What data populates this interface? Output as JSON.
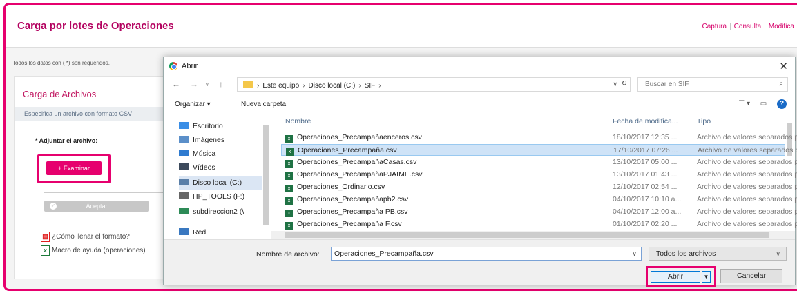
{
  "page": {
    "title": "Carga por lotes de Operaciones",
    "nav": [
      "Captura",
      "Consulta",
      "Modifica"
    ],
    "required_note": "Todos los datos con ( *) son requeridos."
  },
  "panel": {
    "title": "Carga de Archivos",
    "hint": "Especifica un archivo con formato CSV",
    "attach_label": "* Adjuntar el archivo:",
    "browse_button": "+ Examinar",
    "accept_button": "Aceptar",
    "link_format": "¿Cómo llenar el formato?",
    "link_macro": "Macro de ayuda (operaciones)"
  },
  "dialog": {
    "title": "Abrir",
    "breadcrumb": [
      "Este equipo",
      "Disco local (C:)",
      "SIF"
    ],
    "search_placeholder": "Buscar en SIF",
    "organize": "Organizar ▾",
    "new_folder": "Nueva carpeta",
    "tree": [
      {
        "label": "Escritorio",
        "icon": "desktop-icon",
        "color": "#3a8ee6"
      },
      {
        "label": "Imágenes",
        "icon": "pictures-icon",
        "color": "#5b8fc9"
      },
      {
        "label": "Música",
        "icon": "music-icon",
        "color": "#2f7bd0"
      },
      {
        "label": "Vídeos",
        "icon": "videos-icon",
        "color": "#3c4a5c"
      },
      {
        "label": "Disco local (C:)",
        "icon": "drive-icon",
        "color": "#5a7fa8"
      },
      {
        "label": "HP_TOOLS (F:)",
        "icon": "drive-icon",
        "color": "#666666"
      },
      {
        "label": "subdireccion2 (\\",
        "icon": "network-drive-icon",
        "color": "#2e8b57"
      },
      {
        "label": "Red",
        "icon": "network-icon",
        "color": "#3a78c0"
      }
    ],
    "columns": [
      "Nombre",
      "Fecha de modifica...",
      "Tipo"
    ],
    "files": [
      {
        "name": "Operaciones_Precampañaenceros.csv",
        "date": "18/10/2017 12:35 ...",
        "type": "Archivo de valores separados por coma"
      },
      {
        "name": "Operaciones_Precampaña.csv",
        "date": "17/10/2017 07:26 ...",
        "type": "Archivo de valores separados por coma"
      },
      {
        "name": "Operaciones_PrecampañaCasas.csv",
        "date": "13/10/2017 05:00 ...",
        "type": "Archivo de valores separados por coma"
      },
      {
        "name": "Operaciones_PrecampañaPJAIME.csv",
        "date": "13/10/2017 01:43 ...",
        "type": "Archivo de valores separados por coma"
      },
      {
        "name": "Operaciones_Ordinario.csv",
        "date": "12/10/2017 02:54 ...",
        "type": "Archivo de valores separados por coma"
      },
      {
        "name": "Operaciones_Precampañapb2.csv",
        "date": "04/10/2017 10:10 a...",
        "type": "Archivo de valores separados por coma"
      },
      {
        "name": "Operaciones_Precampaña PB.csv",
        "date": "04/10/2017 12:00 a...",
        "type": "Archivo de valores separados por coma"
      },
      {
        "name": "Operaciones_Precampaña F.csv",
        "date": "01/10/2017 02:20 ...",
        "type": "Archivo de valores separados por coma"
      }
    ],
    "filename_label": "Nombre de archivo:",
    "filename_value": "Operaciones_Precampaña.csv",
    "filter_value": "Todos los archivos",
    "open_button": "Abrir",
    "cancel_button": "Cancelar"
  },
  "colors": {
    "accent": "#e6006e",
    "title": "#b3005f"
  }
}
